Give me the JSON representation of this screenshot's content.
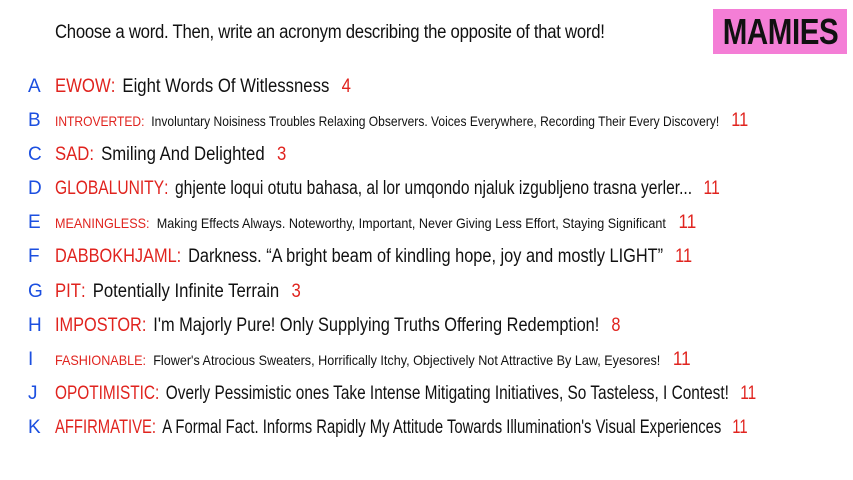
{
  "prompt": "Choose a word. Then, write an acronym describing the opposite of that word!",
  "logo": "MAMIES",
  "items": [
    {
      "letter": "A",
      "word": "EWOW",
      "def": "Eight Words Of Witlessness",
      "num": "4"
    },
    {
      "letter": "B",
      "word": "INTROVERTED",
      "def": "Involuntary Noisiness Troubles Relaxing Observers. Voices Everywhere, Recording Their Every Discovery!",
      "num": "11"
    },
    {
      "letter": "C",
      "word": "SAD",
      "def": "Smiling And Delighted",
      "num": "3"
    },
    {
      "letter": "D",
      "word": "GLOBALUNITY",
      "def": "ghjente loqui otutu bahasa, al lor umqondo njaluk izgubljeno trasna yerler...",
      "num": "11"
    },
    {
      "letter": "E",
      "word": "MEANINGLESS",
      "def": "Making Effects Always. Noteworthy, Important, Never Giving Less Effort, Staying Significant",
      "num": "11"
    },
    {
      "letter": "F",
      "word": "DABBOKHJAML",
      "def": "Darkness. “A bright beam of kindling hope, joy and mostly LIGHT”",
      "num": "11"
    },
    {
      "letter": "G",
      "word": "PIT",
      "def": "Potentially Infinite Terrain",
      "num": "3"
    },
    {
      "letter": "H",
      "word": "IMPOSTOR",
      "def": "I'm Majorly Pure! Only Supplying Truths Offering Redemption!",
      "num": "8"
    },
    {
      "letter": "I",
      "word": "FASHIONABLE",
      "def": "Flower's Atrocious Sweaters, Horrifically Itchy, Objectively Not Attractive By Law, Eyesores!",
      "num": "11"
    },
    {
      "letter": "J",
      "word": "OPOTIMISTIC",
      "def": "Overly Pessimistic ones Take Intense Mitigating Initiatives, So Tasteless, I Contest!",
      "num": "11"
    },
    {
      "letter": "K",
      "word": "AFFIRMATIVE",
      "def": "A Formal Fact. Informs Rapidly My Attitude Towards Illumination's Visual Experiences",
      "num": "11"
    }
  ],
  "colors": {
    "word": "#e0231e",
    "letter": "#1c4fe0",
    "logo_bg": "#f47ed6"
  }
}
